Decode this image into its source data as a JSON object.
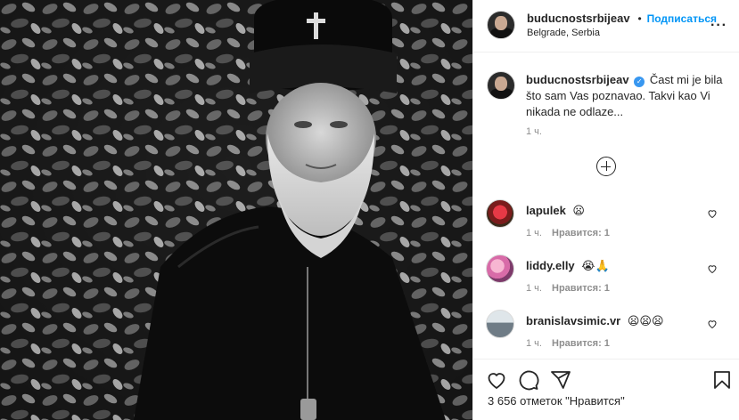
{
  "post": {
    "username": "buducnostsrbijeav",
    "follow_label": "Подписаться",
    "separator": "•",
    "location": "Belgrade, Serbia",
    "more_label": "···",
    "caption_text": "Čast mi je bila što sam Vas poznavao. Takvi kao Vi nikada ne odlaze...",
    "caption_time": "1 ч.",
    "likes_text": "3 656 отметок \"Нравится\""
  },
  "comments": [
    {
      "username": "lapulek",
      "text": "😦",
      "time": "1 ч.",
      "likes": "Нравится: 1"
    },
    {
      "username": "liddy.elly",
      "text": "😭🙏",
      "time": "1 ч.",
      "likes": "Нравится: 1"
    },
    {
      "username": "branislavsimic.vr",
      "text": "😦😦😦",
      "time": "1 ч.",
      "likes": "Нравится: 1"
    }
  ],
  "icons": {
    "like": "heart-icon",
    "comment": "comment-icon",
    "share": "send-icon",
    "save": "bookmark-icon",
    "load_more": "plus-circle-icon",
    "verified": "verified-badge-icon"
  },
  "colors": {
    "link_blue": "#0095f6",
    "verified_blue": "#3897f0",
    "secondary_text": "#8e8e8e"
  }
}
